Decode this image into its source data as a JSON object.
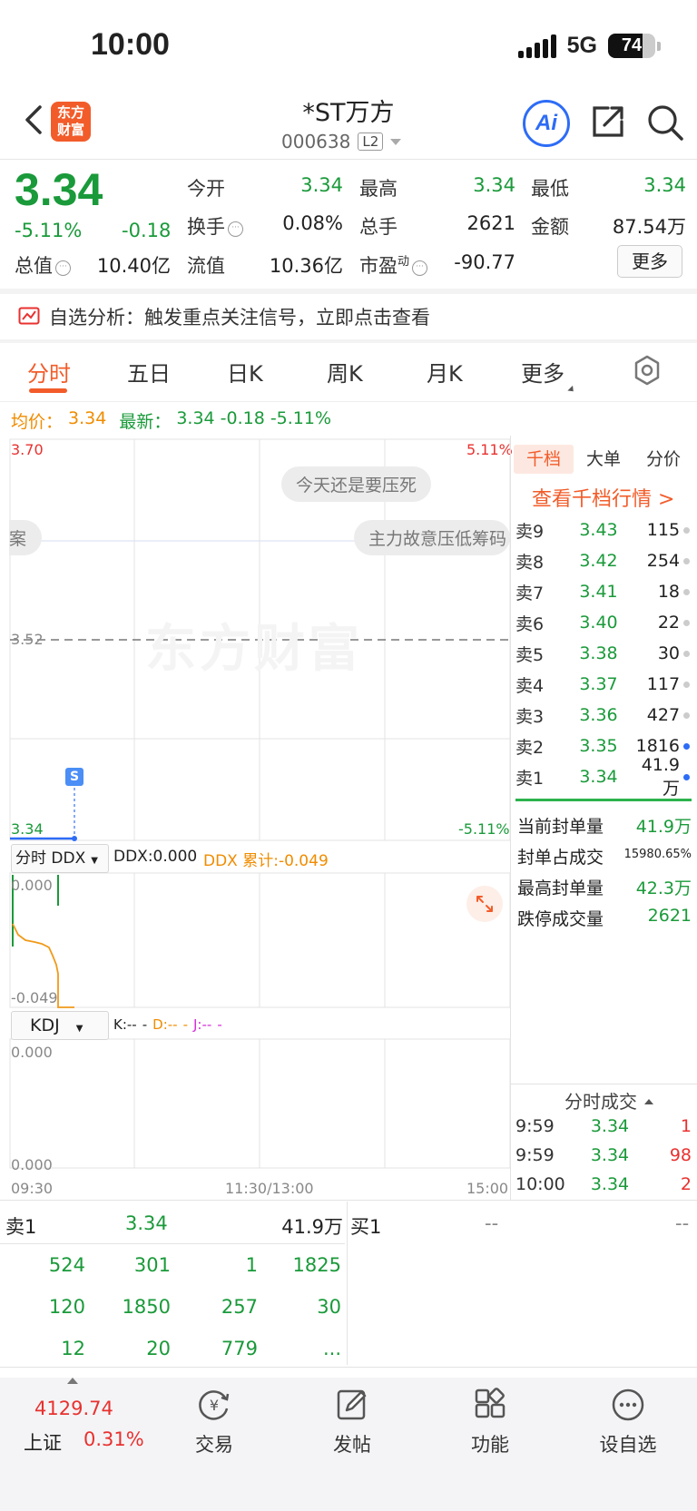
{
  "status_bar": {
    "time": "10:00",
    "network": "5G",
    "battery": "74",
    "battery_level": 0.74
  },
  "header": {
    "logo_top": "东方",
    "logo_bottom": "财富",
    "stock_name": "*ST万方",
    "stock_code": "000638",
    "level_badge": "L2",
    "ai_label": "Ai"
  },
  "quote": {
    "price": "3.34",
    "change_pct": "-5.11%",
    "change_abs": "-0.18",
    "open_label": "今开",
    "open": "3.34",
    "high_label": "最高",
    "high": "3.34",
    "low_label": "最低",
    "low": "3.34",
    "turnover_label": "换手",
    "turnover": "0.08%",
    "volume_label": "总手",
    "volume": "2621",
    "amount_label": "金额",
    "amount": "87.54万",
    "mktcap_label": "总值",
    "mktcap": "10.40亿",
    "float_label": "流值",
    "float": "10.36亿",
    "pe_label": "市盈",
    "pe_sup": "动",
    "pe": "-90.77",
    "more_label": "更多"
  },
  "analysis_banner": "自选分析：触发重点关注信号，立即点击查看",
  "tabs": [
    "分时",
    "五日",
    "日K",
    "周K",
    "月K",
    "更多"
  ],
  "avg_line": {
    "avg_label": "均价：",
    "avg": "3.34",
    "latest_label": "最新：",
    "latest": "3.34",
    "chg": "-0.18",
    "pct": "-5.11%"
  },
  "chart": {
    "y_top": "3.70",
    "y_mid": "3.52",
    "y_bottom": "3.34",
    "pct_top": "5.11%",
    "pct_bottom": "-5.11%",
    "watermark": "东方财富",
    "bubble1": "今天还是要压死",
    "bubble2": "主力故意压低筹码",
    "bubble3": "案",
    "marker": "S",
    "ddx_selector": "分时 DDX",
    "ddx_value": "DDX:0.000",
    "ddx_cum": "DDX 累计:-0.049",
    "ddx_top": "0.000",
    "ddx_bottom": "-0.049",
    "kdj_selector": "KDJ",
    "kdj_k": "K:--",
    "kdj_d": "D:--",
    "kdj_j": "J:--",
    "kdj_top": "0.000",
    "kdj_bottom": "0.000",
    "time_start": "09:30",
    "time_mid": "11:30/13:00",
    "time_end": "15:00"
  },
  "order_book": {
    "tabs": [
      "千档",
      "大单",
      "分价"
    ],
    "link": "查看千档行情 >",
    "asks": [
      {
        "label": "卖9",
        "price": "3.43",
        "vol": "115"
      },
      {
        "label": "卖8",
        "price": "3.42",
        "vol": "254"
      },
      {
        "label": "卖7",
        "price": "3.41",
        "vol": "18"
      },
      {
        "label": "卖6",
        "price": "3.40",
        "vol": "22"
      },
      {
        "label": "卖5",
        "price": "3.38",
        "vol": "30"
      },
      {
        "label": "卖4",
        "price": "3.37",
        "vol": "117"
      },
      {
        "label": "卖3",
        "price": "3.36",
        "vol": "427"
      },
      {
        "label": "卖2",
        "price": "3.35",
        "vol": "1816"
      },
      {
        "label": "卖1",
        "price": "3.34",
        "vol": "41.9万"
      }
    ],
    "seal": [
      {
        "label": "当前封单量",
        "value": "41.9万"
      },
      {
        "label": "封单占成交",
        "value": "15980.65%"
      },
      {
        "label": "最高封单量",
        "value": "42.3万"
      },
      {
        "label": "跌停成交量",
        "value": "2621"
      }
    ],
    "trades_header": "分时成交",
    "trades": [
      {
        "time": "9:59",
        "price": "3.34",
        "vol": "1"
      },
      {
        "time": "9:59",
        "price": "3.34",
        "vol": "98"
      },
      {
        "time": "10:00",
        "price": "3.34",
        "vol": "2"
      }
    ]
  },
  "bottom_book": {
    "ask_label": "卖1",
    "ask_price": "3.34",
    "ask_vol": "41.9万",
    "bid_label": "买1",
    "bid_price": "--",
    "bid_vol": "--",
    "queue": [
      [
        "524",
        "301",
        "1",
        "1825"
      ],
      [
        "120",
        "1850",
        "257",
        "30"
      ],
      [
        "12",
        "20",
        "779",
        "..."
      ]
    ]
  },
  "nav": {
    "index_value": "4129.74",
    "index_name": "上证",
    "index_pct": "0.31%",
    "items": [
      "交易",
      "发帖",
      "功能",
      "设自选"
    ]
  },
  "colors": {
    "green": "#1a9a3a",
    "red": "#e8312f",
    "orange": "#f25c2a",
    "blue": "#2d6cf6"
  }
}
